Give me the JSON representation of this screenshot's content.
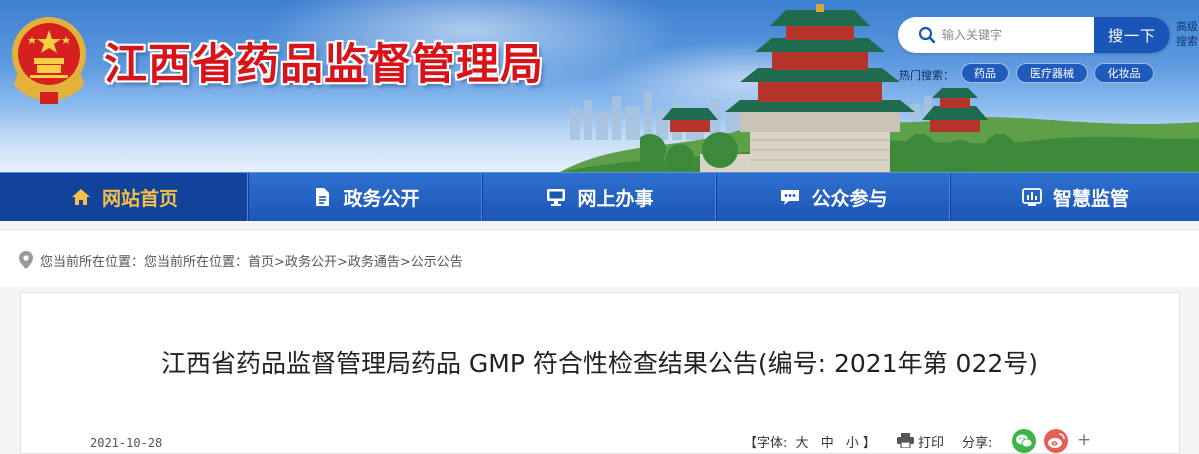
{
  "header": {
    "site_title": "江西省药品监督管理局",
    "search": {
      "placeholder": "输入关键字",
      "button_label": "搜一下",
      "advanced_label": "高级搜索"
    },
    "hot_search": {
      "label": "热门搜索：",
      "tags": [
        "药品",
        "医疗器械",
        "化妆品"
      ]
    }
  },
  "nav": {
    "items": [
      {
        "label": "网站首页",
        "icon": "home-icon"
      },
      {
        "label": "政务公开",
        "icon": "document-icon"
      },
      {
        "label": "网上办事",
        "icon": "monitor-icon"
      },
      {
        "label": "公众参与",
        "icon": "chat-icon"
      },
      {
        "label": "智慧监管",
        "icon": "dashboard-icon"
      }
    ],
    "active_index": 0
  },
  "breadcrumb": {
    "prefix": "您当前所在位置：您当前所在位置：",
    "items": [
      "首页",
      "政务公开",
      "政务通告",
      "公示公告"
    ],
    "separator": ">"
  },
  "article": {
    "title": "江西省药品监督管理局药品 GMP 符合性检查结果公告(编号: 2021年第 022号)",
    "date": "2021-10-28",
    "font_size": {
      "open": "【字体:",
      "large": "大",
      "medium": "中",
      "small": "小",
      "close": "】"
    },
    "print_label": "打印",
    "share_label": "分享:",
    "share_icons": [
      "wechat-icon",
      "weibo-icon",
      "plus-icon"
    ]
  },
  "colors": {
    "title_red": "#d8141a",
    "nav_blue": "#1c56b6",
    "nav_active": "#12429a",
    "nav_active_text": "#f5c04a",
    "search_button": "#1a56b8"
  }
}
